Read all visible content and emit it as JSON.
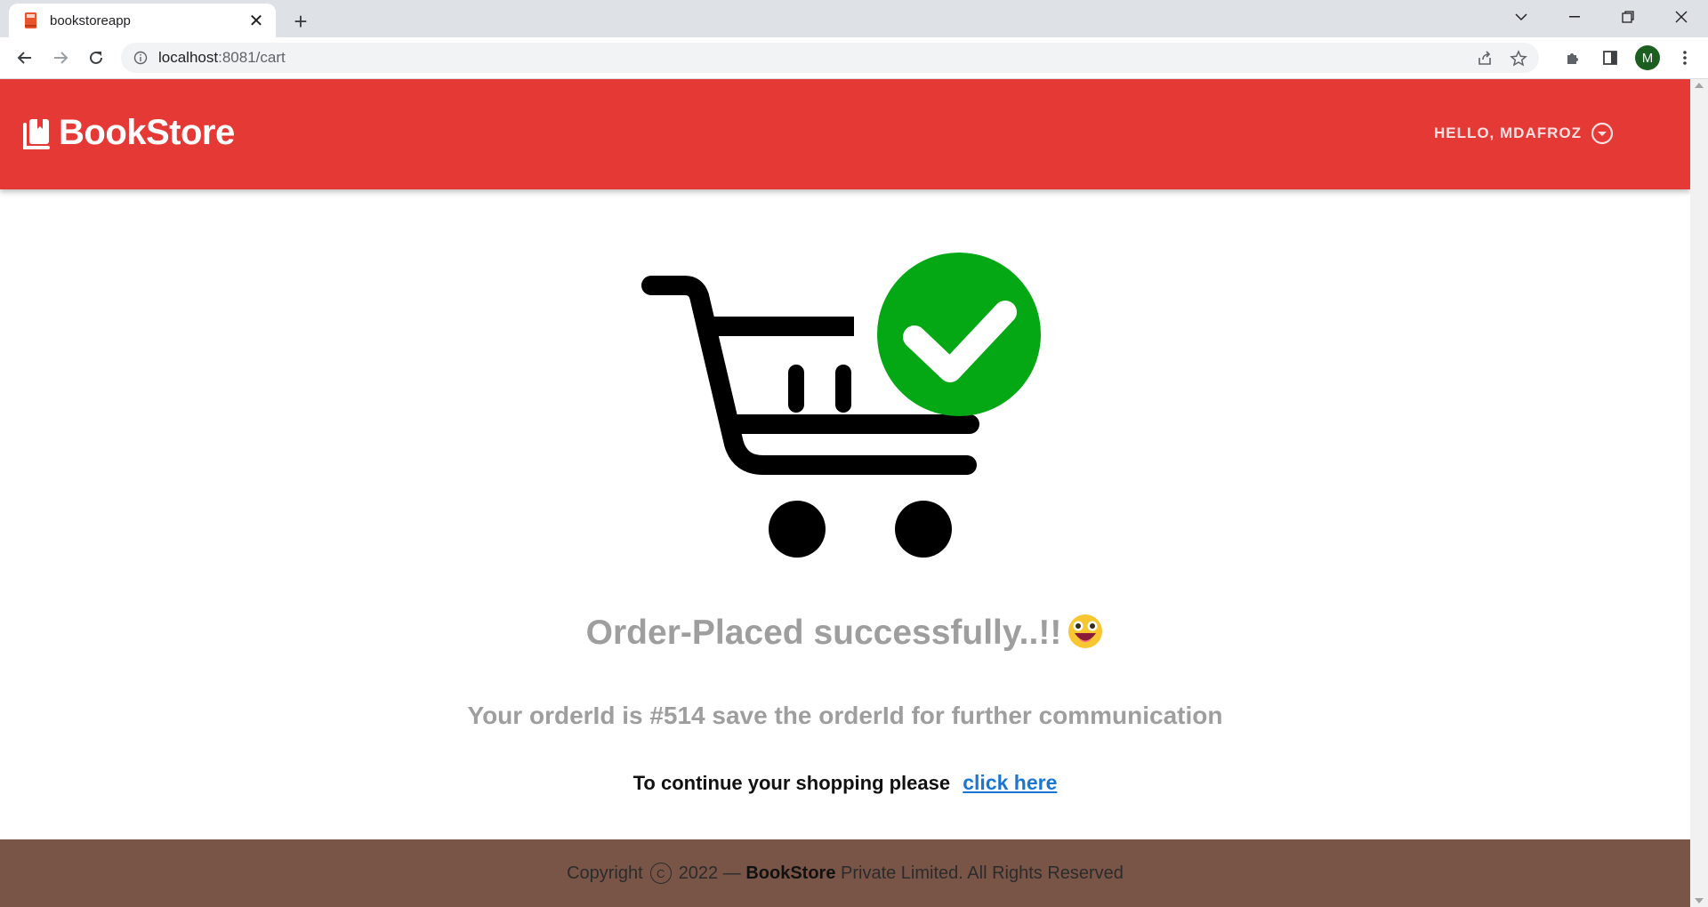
{
  "browser": {
    "tab_title": "bookstoreapp",
    "url_host": "localhost",
    "url_path": ":8081/cart",
    "profile_initial": "M"
  },
  "header": {
    "brand": "BookStore",
    "greeting": "HELLO, MDAFROZ",
    "color": "#e53935"
  },
  "main": {
    "headline": "Order-Placed successfully..!!",
    "order_message": "Your orderId is #514 save the orderId for further communication",
    "continue_text": "To continue your shopping please",
    "continue_link": "click here",
    "check_color": "#04a815"
  },
  "footer": {
    "prefix": "Copyright",
    "copy_symbol": "C",
    "year_dash": "2022 —",
    "brand": "BookStore",
    "suffix": "Private Limited. All Rights Reserved",
    "color": "#795548"
  }
}
